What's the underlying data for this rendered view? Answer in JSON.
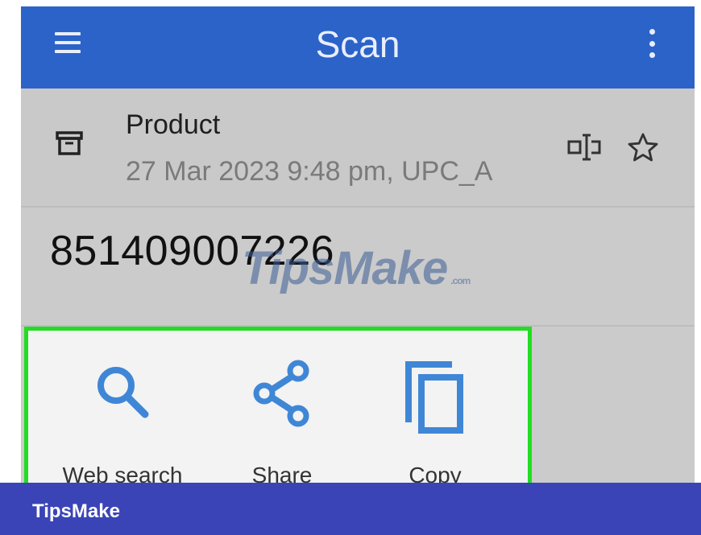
{
  "appbar": {
    "title": "Scan",
    "menu_icon": "hamburger-menu-icon",
    "overflow_icon": "more-vert-icon",
    "color": "#2b63c9"
  },
  "result": {
    "type": "Product",
    "subtitle": "27 Mar 2023 9:48 pm, UPC_A",
    "code": "851409007226",
    "type_icon": "box-icon",
    "barcode_icon": "barcode-icon",
    "favorite_icon": "star-outline-icon"
  },
  "actions": [
    {
      "label": "Web search",
      "icon": "search-icon"
    },
    {
      "label": "Share",
      "icon": "share-icon"
    },
    {
      "label": "Copy",
      "icon": "copy-icon"
    }
  ],
  "highlight_color": "#22dd22",
  "accent_color": "#3f87d6",
  "watermark": {
    "text": "TipsMake",
    "suffix": ".com"
  },
  "footer": {
    "brand": "TipsMake",
    "color": "#3b44b6"
  }
}
